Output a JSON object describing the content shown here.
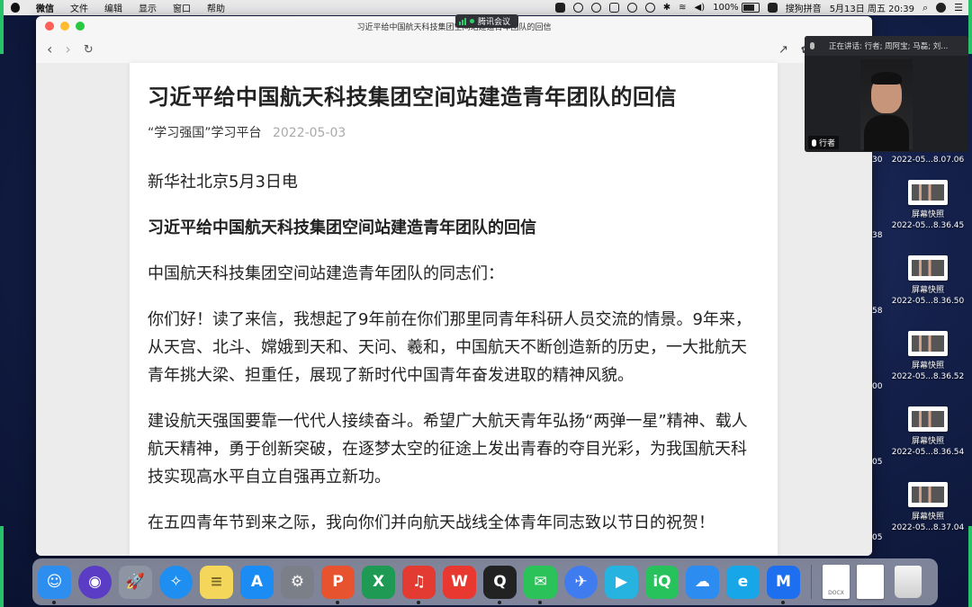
{
  "menubar": {
    "app_name": "微信",
    "menus": [
      "文件",
      "编辑",
      "显示",
      "窗口",
      "帮助"
    ],
    "battery": "100%",
    "input_method": "搜狗拼音",
    "datetime": "5月13日 周五  20:39"
  },
  "meeting": {
    "label": "腾讯会议"
  },
  "browser": {
    "window_title": "习近平给中国航天科技集团空间站建造青年团队的回信"
  },
  "article": {
    "title": "习近平给中国航天科技集团空间站建造青年团队的回信",
    "source": "“学习强国”学习平台",
    "date": "2022-05-03",
    "paragraphs": [
      "新华社北京5月3日电",
      "习近平给中国航天科技集团空间站建造青年团队的回信",
      "中国航天科技集团空间站建造青年团队的同志们：",
      "你们好！读了来信，我想起了9年前在你们那里同青年科研人员交流的情景。9年来，从天宫、北斗、嫦娥到天和、天问、羲和，中国航天不断创造新的历史，一大批航天青年挑大梁、担重任，展现了新时代中国青年奋发进取的精神风貌。",
      "建设航天强国要靠一代代人接续奋斗。希望广大航天青年弘扬“两弹一星”精神、载人航天精神，勇于创新突破，在逐梦太空的征途上发出青春的夺目光彩，为我国航天科技实现高水平自立自强再立新功。",
      "在五四青年节到来之际，我向你们并向航天战线全体青年同志致以节日的祝贺！"
    ]
  },
  "video_panel": {
    "speaking": "正在讲话: 行者; 周阿宝; 马磊; 刘...",
    "participant_name": "行者"
  },
  "desktop_files": [
    {
      "label1": "",
      "label2": "2022-05...8.07.06",
      "edge": "30"
    },
    {
      "label1": "屏幕快照",
      "label2": "2022-05...8.36.45",
      "edge": "38"
    },
    {
      "label1": "屏幕快照",
      "label2": "2022-05...8.36.50",
      "edge": "58"
    },
    {
      "label1": "屏幕快照",
      "label2": "2022-05...8.36.52",
      "edge": "00"
    },
    {
      "label1": "屏幕快照",
      "label2": "2022-05...8.36.54",
      "edge": "05"
    },
    {
      "label1": "屏幕快照",
      "label2": "2022-05...8.37.04",
      "edge": "05"
    }
  ],
  "dock": {
    "apps": [
      {
        "name": "finder",
        "glyph": "☺",
        "color": "#2e8ef0"
      },
      {
        "name": "siri",
        "glyph": "◉",
        "color": "#5b3cc4"
      },
      {
        "name": "launchpad",
        "glyph": "🚀",
        "color": "#8d95a3"
      },
      {
        "name": "safari",
        "glyph": "✧",
        "color": "#1f8ef1"
      },
      {
        "name": "notes",
        "glyph": "≡",
        "color": "#f3d65a"
      },
      {
        "name": "app-store",
        "glyph": "A",
        "color": "#1a8cf4"
      },
      {
        "name": "system-preferences",
        "glyph": "⚙",
        "color": "#7b7f87"
      },
      {
        "name": "powerpoint",
        "glyph": "P",
        "color": "#e8532f"
      },
      {
        "name": "excel",
        "glyph": "X",
        "color": "#1f9a55"
      },
      {
        "name": "netease-music",
        "glyph": "♫",
        "color": "#e33a32"
      },
      {
        "name": "wps",
        "glyph": "W",
        "color": "#e8382f"
      },
      {
        "name": "qq",
        "glyph": "Q",
        "color": "#222222"
      },
      {
        "name": "wechat",
        "glyph": "✉",
        "color": "#2bc25a"
      },
      {
        "name": "lark",
        "glyph": "✈",
        "color": "#3f7cf0"
      },
      {
        "name": "video-player",
        "glyph": "▶",
        "color": "#27b3e0"
      },
      {
        "name": "iqiyi",
        "glyph": "iQ",
        "color": "#27c25c"
      },
      {
        "name": "baidu-netdisk",
        "glyph": "☁",
        "color": "#2d8cf0"
      },
      {
        "name": "browser",
        "glyph": "e",
        "color": "#17a6e8"
      },
      {
        "name": "tencent-meeting",
        "glyph": "M",
        "color": "#1e6ff0"
      }
    ],
    "doc_label": "DOCX"
  }
}
